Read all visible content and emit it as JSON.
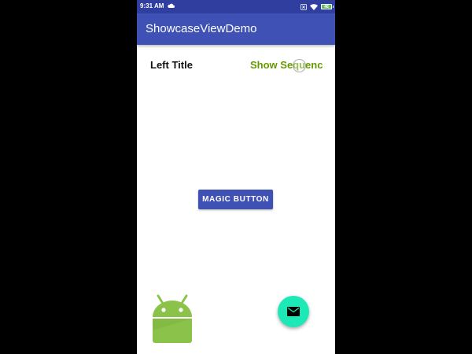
{
  "status_bar": {
    "time": "9:31 AM",
    "battery": "46",
    "icons": [
      "cloud-icon",
      "mute-icon",
      "wifi-icon",
      "battery-icon"
    ]
  },
  "app_bar": {
    "title": "ShowcaseViewDemo"
  },
  "content": {
    "left_title": "Left Title",
    "show_sequence": "Show Sequence",
    "magic_button": "MAGIC BUTTON"
  },
  "fab": {
    "icon": "mail-icon"
  },
  "colors": {
    "status_bar": "#303f9f",
    "app_bar": "#3f51b5",
    "accent_green": "#669900",
    "fab": "#1de9b6",
    "android_green": "#8bc34a"
  }
}
